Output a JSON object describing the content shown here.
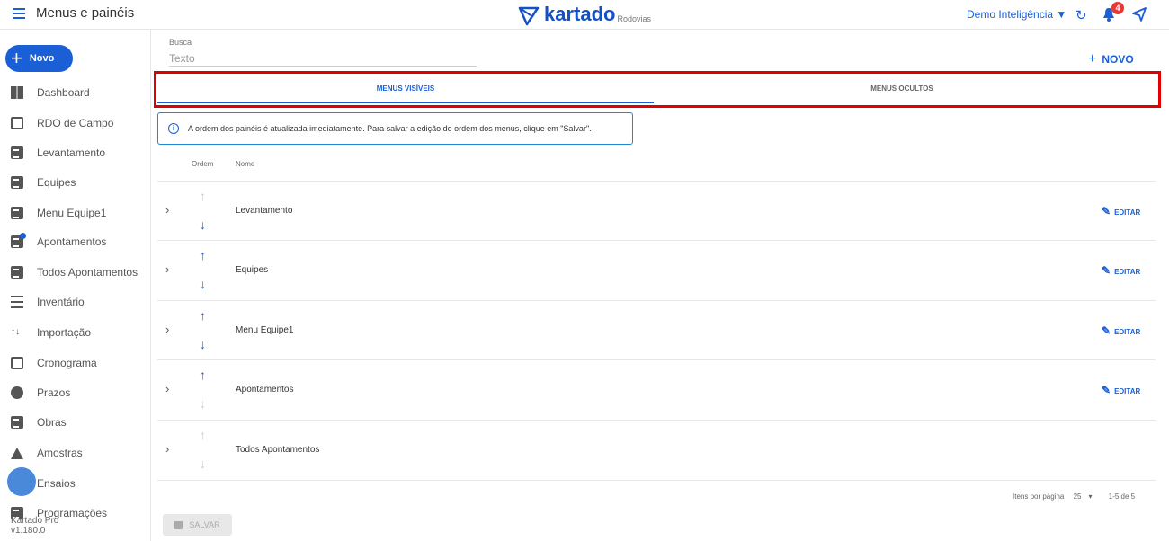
{
  "topbar": {
    "title": "Menus e painéis",
    "brand": "kartado",
    "brand_sub": "Rodovias",
    "org": "Demo Inteligência ▼",
    "notifications": "4",
    "brand_color": "#1451c4"
  },
  "sidebar": {
    "new_label": "Novo",
    "items": [
      {
        "label": "Dashboard",
        "icon": "dashboard-icon"
      },
      {
        "label": "RDO de Campo",
        "icon": "clipboard-icon"
      },
      {
        "label": "Levantamento",
        "icon": "list-doc-icon"
      },
      {
        "label": "Equipes",
        "icon": "list-doc-icon"
      },
      {
        "label": "Menu Equipe1",
        "icon": "list-doc-icon"
      },
      {
        "label": "Apontamentos",
        "icon": "list-doc-icon"
      },
      {
        "label": "Todos Apontamentos",
        "icon": "list-doc-icon"
      },
      {
        "label": "Inventário",
        "icon": "list-icon"
      },
      {
        "label": "Importação",
        "icon": "import-icon"
      },
      {
        "label": "Cronograma",
        "icon": "calendar-icon"
      },
      {
        "label": "Prazos",
        "icon": "clock-icon"
      },
      {
        "label": "Obras",
        "icon": "clipboard-icon"
      },
      {
        "label": "Amostras",
        "icon": "flask-icon"
      },
      {
        "label": "Ensaios",
        "icon": "chat-icon"
      },
      {
        "label": "Programações",
        "icon": "book-icon"
      }
    ],
    "version_name": "Kartado Pro",
    "version": "v1.180.0"
  },
  "search": {
    "label": "Busca",
    "placeholder": "Texto"
  },
  "novo_link": "NOVO",
  "tabs": [
    {
      "label": "MENUS VISÍVEIS",
      "active": true
    },
    {
      "label": "MENUS OCULTOS",
      "active": false
    }
  ],
  "info": "A ordem dos painéis é atualizada imediatamente. Para salvar a edição de ordem dos menus, clique em \"Salvar\".",
  "table": {
    "headers": [
      "Ordem",
      "Nome"
    ],
    "rows": [
      {
        "name": "Levantamento",
        "up": false,
        "down": true,
        "editable": true
      },
      {
        "name": "Equipes",
        "up": true,
        "down": true,
        "editable": true
      },
      {
        "name": "Menu Equipe1",
        "up": true,
        "down": true,
        "editable": true
      },
      {
        "name": "Apontamentos",
        "up": true,
        "down": false,
        "editable": true
      },
      {
        "name": "Todos Apontamentos",
        "up": false,
        "down": false,
        "editable": false
      }
    ],
    "edit_label": "EDITAR"
  },
  "pagination": {
    "per_page_label": "Itens por página",
    "per_page": "25",
    "range": "1-5 de 5"
  },
  "save_label": "SALVAR"
}
